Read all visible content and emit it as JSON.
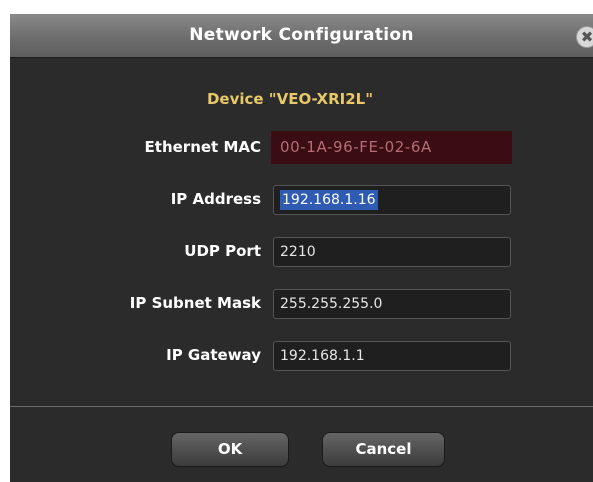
{
  "dialog": {
    "title": "Network Configuration",
    "close_glyph": "✖",
    "close_icon": "close-icon"
  },
  "device": {
    "title": "Device \"VEO-XRI2L\""
  },
  "fields": {
    "mac": {
      "label": "Ethernet MAC",
      "value": "00-1A-96-FE-02-6A"
    },
    "ip": {
      "label": "IP Address",
      "value": "192.168.1.16",
      "selected": true
    },
    "udp": {
      "label": "UDP Port",
      "value": "2210"
    },
    "mask": {
      "label": "IP Subnet Mask",
      "value": "255.255.255.0"
    },
    "gateway": {
      "label": "IP Gateway",
      "value": "192.168.1.1"
    }
  },
  "buttons": {
    "ok": "OK",
    "cancel": "Cancel"
  },
  "colors": {
    "device_title": "#e9c86a",
    "mac_background": "#3a0d12",
    "mac_text": "#b46d74",
    "selection": "#2f5bb3",
    "dialog_background": "#2b2b2b"
  }
}
